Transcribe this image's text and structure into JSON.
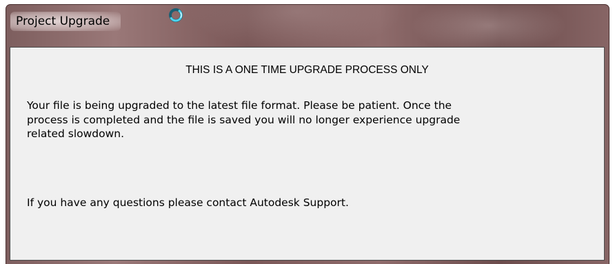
{
  "window": {
    "title": "Project Upgrade",
    "busy_icon": "spinning-progress-ring-icon",
    "accent_color": "#2aa8c8"
  },
  "content": {
    "heading": "THIS IS A ONE TIME UPGRADE PROCESS ONLY",
    "paragraph_lines": [
      "Your file is being upgraded to the latest file format.  Please be patient.  Once the",
      "process is completed and the file is saved you will no longer experience upgrade",
      "related slowdown."
    ],
    "contact": "If you have any questions please contact Autodesk Support."
  }
}
